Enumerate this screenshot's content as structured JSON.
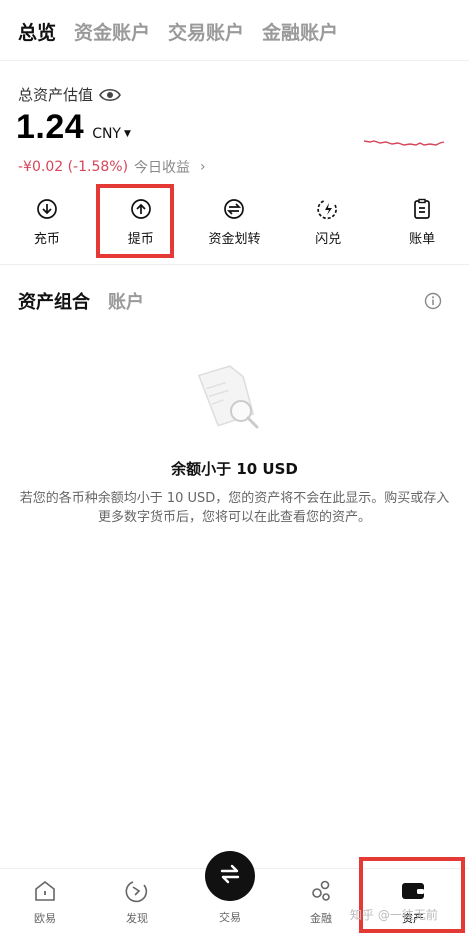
{
  "tabs": [
    "总览",
    "资金账户",
    "交易账户",
    "金融账户"
  ],
  "balance": {
    "label": "总资产估值",
    "value": "1.24",
    "currency": "CNY",
    "pnl_value": "-¥0.02 (-1.58%)",
    "pnl_label": "今日收益"
  },
  "actions": [
    {
      "label": "充币",
      "icon": "deposit-icon"
    },
    {
      "label": "提币",
      "icon": "withdraw-icon"
    },
    {
      "label": "资金划转",
      "icon": "transfer-icon"
    },
    {
      "label": "闪兑",
      "icon": "flash-swap-icon"
    },
    {
      "label": "账单",
      "icon": "bill-icon"
    }
  ],
  "asset_tabs": [
    "资产组合",
    "账户"
  ],
  "empty": {
    "title": "余额小于 10 USD",
    "description": "若您的各币种余额均小于 10 USD，您的资产将不会在此显示。购买或存入更多数字货币后，您将可以在此查看您的资产。"
  },
  "nav": [
    {
      "label": "欧易",
      "icon": "home-icon"
    },
    {
      "label": "发现",
      "icon": "discover-icon"
    },
    {
      "label": "交易",
      "icon": "trade-icon"
    },
    {
      "label": "金融",
      "icon": "finance-icon"
    },
    {
      "label": "资产",
      "icon": "wallet-icon"
    }
  ],
  "watermark": "知乎 @一往无前",
  "colors": {
    "highlight": "#e53935",
    "negative": "#d6465a"
  }
}
